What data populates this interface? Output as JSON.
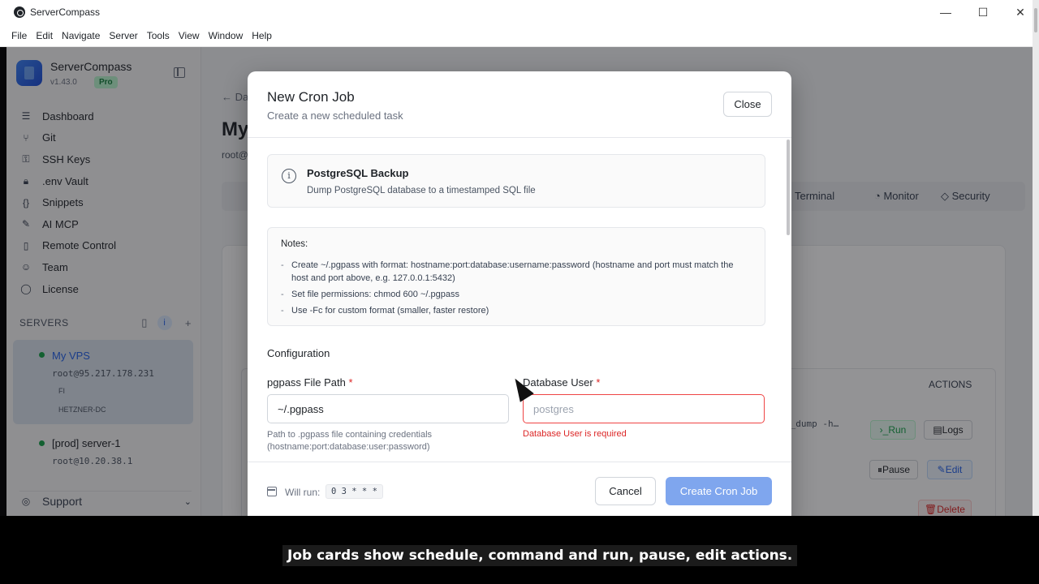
{
  "window": {
    "title": "ServerCompass",
    "controls": [
      "—",
      "☐",
      "✕"
    ]
  },
  "menu": [
    "File",
    "Edit",
    "Navigate",
    "Server",
    "Tools",
    "View",
    "Window",
    "Help"
  ],
  "sidebar": {
    "brand_name": "ServerCompass",
    "version": "v1.43.0",
    "plan": "Pro",
    "nav": [
      {
        "label": "Dashboard",
        "icon": "☰"
      },
      {
        "label": "Git",
        "icon": "⑂"
      },
      {
        "label": "SSH Keys",
        "icon": "⚿"
      },
      {
        "label": ".env Vault",
        "icon": "🔒︎"
      },
      {
        "label": "Snippets",
        "icon": "{}"
      },
      {
        "label": "AI MCP",
        "icon": "✎"
      },
      {
        "label": "Remote Control",
        "icon": "▯"
      },
      {
        "label": "Team",
        "icon": "☺"
      },
      {
        "label": "License",
        "icon": "◯"
      }
    ],
    "servers_title": "SERVERS",
    "servers": [
      {
        "name": "My VPS",
        "address": "root@95.217.178.231",
        "tags": [
          "FI",
          "HETZNER-DC"
        ]
      },
      {
        "name": "[prod] server-1",
        "address": "root@10.20.38.1",
        "tags": []
      }
    ],
    "support": "Support"
  },
  "background": {
    "crumb": "Da",
    "title": "My",
    "sub": "root@",
    "tabs": [
      "Terminal",
      "Monitor",
      "Security"
    ],
    "actions_header": "ACTIONS",
    "command": "g_dump -h…",
    "buttons": {
      "run": "Run",
      "logs": "Logs",
      "pause": "Pause",
      "edit": "Edit",
      "delete": "Delete"
    }
  },
  "modal": {
    "title": "New Cron Job",
    "subtitle": "Create a new scheduled task",
    "close": "Close",
    "template": {
      "name": "PostgreSQL Backup",
      "description": "Dump PostgreSQL database to a timestamped SQL file"
    },
    "notes_title": "Notes:",
    "notes": [
      "Create ~/.pgpass with format: hostname:port:database:username:password (hostname and port must match the host and port above, e.g. 127.0.0.1:5432)",
      "Set file permissions: chmod 600 ~/.pgpass",
      "Use -Fc for custom format (smaller, faster restore)"
    ],
    "config_title": "Configuration",
    "fields": {
      "pgpass": {
        "label": "pgpass File Path",
        "value": "~/.pgpass",
        "help": "Path to .pgpass file containing credentials (hostname:port:database:user:password)"
      },
      "db_user": {
        "label": "Database User",
        "placeholder": "postgres",
        "error": "Database User is required"
      }
    },
    "will_run_label": "Will run:",
    "cron": "0 3 * * *",
    "cancel": "Cancel",
    "create": "Create Cron Job"
  },
  "caption": "Job cards show schedule, command and run, pause, edit actions."
}
